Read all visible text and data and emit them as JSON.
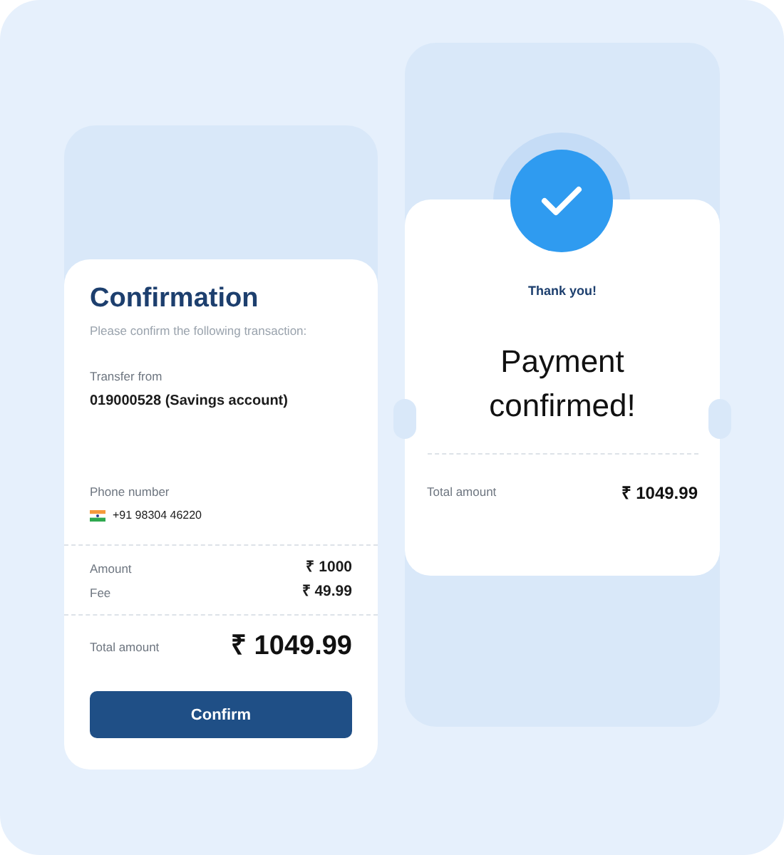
{
  "confirmation": {
    "title": "Confirmation",
    "subtitle": "Please confirm the following transaction:",
    "transfer_from": {
      "label": "Transfer from",
      "value": "019000528 (Savings account)"
    },
    "phone": {
      "label": "Phone number",
      "value": "+91 98304 46220"
    },
    "lines": [
      {
        "label": "Amount",
        "value": "₹ 1000"
      },
      {
        "label": "Fee",
        "value": "₹ 49.99"
      }
    ],
    "total": {
      "label": "Total amount",
      "value": "₹ 1049.99"
    },
    "button": "Confirm"
  },
  "success": {
    "heading": "Thank you!",
    "title": "Payment confirmed!",
    "total": {
      "label": "Total amount",
      "value": "₹ 1049.99"
    }
  }
}
